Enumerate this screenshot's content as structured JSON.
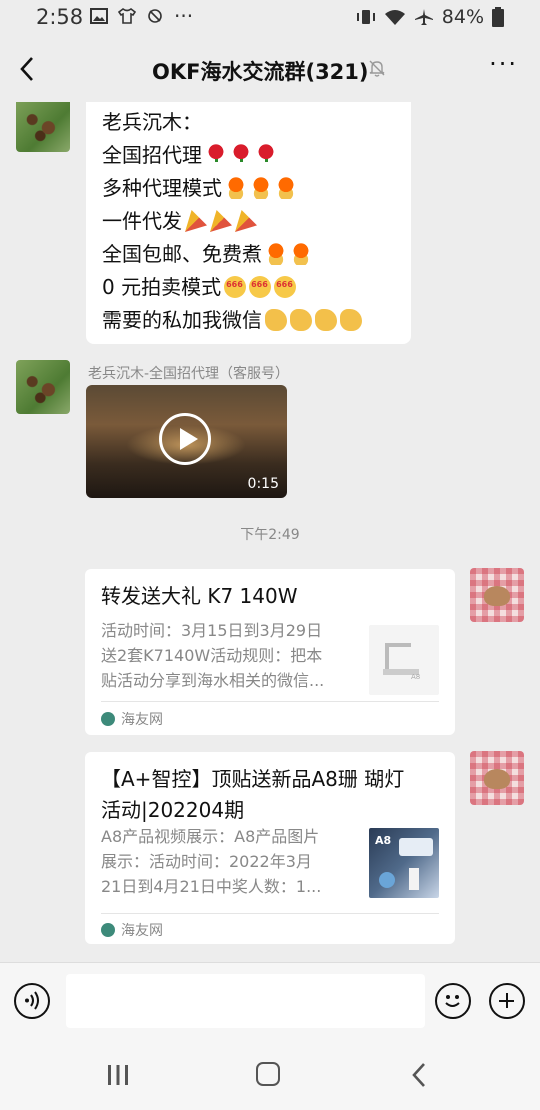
{
  "status_bar": {
    "time": "2:58",
    "more": "···",
    "battery": "84%"
  },
  "header": {
    "title": "OKF海水交流群(321)",
    "more": "···"
  },
  "messages": {
    "first": {
      "lines": [
        "老兵沉木：",
        "全国招代理",
        "多种代理模式",
        "一件代发",
        "全国包邮、免费煮",
        "0 元拍卖模式",
        "需要的私加我微信"
      ]
    },
    "video": {
      "sender": "老兵沉木-全国招代理（客服号）",
      "duration": "0:15"
    },
    "timestamp": "下午2:49",
    "card1": {
      "title": "转发送大礼  K7 140W",
      "desc_lines": [
        "活动时间：3月15日到3月29日",
        "送2套K7140W活动规则：把本",
        "贴活动分享到海水相关的微信..."
      ],
      "source": "海友网",
      "thumb_label": "A8"
    },
    "card2": {
      "title_lines": [
        "【A+智控】顶贴送新品A8珊 瑚灯",
        "活动|202204期"
      ],
      "desc_lines": [
        "A8产品视频展示：A8产品图片",
        "展示：活动时间：2022年3月",
        "21日到4月21日中奖人数：1..."
      ],
      "source": "海友网",
      "thumb_label": "A8"
    }
  },
  "input": {
    "placeholder": ""
  }
}
